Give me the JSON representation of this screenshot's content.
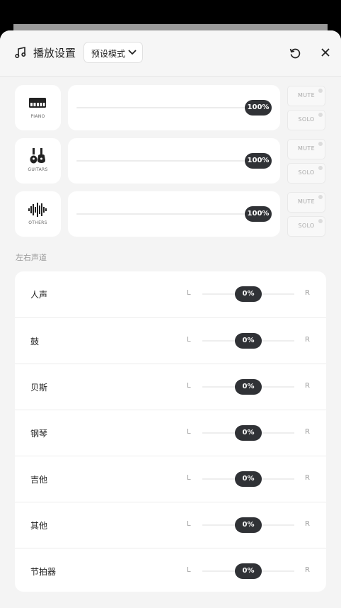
{
  "header": {
    "title": "播放设置",
    "preset_label": "预设模式",
    "icons": {
      "title": "music-note-icon",
      "preset": "chevron-down-icon",
      "reset": "reset-icon",
      "close": "close-icon"
    }
  },
  "tracks": [
    {
      "name": "PIANO",
      "icon": "piano-icon",
      "volume_percent": 100,
      "volume_label": "100%",
      "mute_label": "MUTE",
      "solo_label": "SOLO"
    },
    {
      "name": "GUITARS",
      "icon": "guitars-icon",
      "volume_percent": 100,
      "volume_label": "100%",
      "mute_label": "MUTE",
      "solo_label": "SOLO"
    },
    {
      "name": "OTHERS",
      "icon": "waveform-icon",
      "volume_percent": 100,
      "volume_label": "100%",
      "mute_label": "MUTE",
      "solo_label": "SOLO"
    }
  ],
  "pan_section": {
    "title": "左右声道",
    "left_label": "L",
    "right_label": "R",
    "rows": [
      {
        "name": "人声",
        "pan_value": 0,
        "pan_label": "0%"
      },
      {
        "name": "鼓",
        "pan_value": 0,
        "pan_label": "0%"
      },
      {
        "name": "贝斯",
        "pan_value": 0,
        "pan_label": "0%"
      },
      {
        "name": "钢琴",
        "pan_value": 0,
        "pan_label": "0%"
      },
      {
        "name": "吉他",
        "pan_value": 0,
        "pan_label": "0%"
      },
      {
        "name": "其他",
        "pan_value": 0,
        "pan_label": "0%"
      },
      {
        "name": "节拍器",
        "pan_value": 0,
        "pan_label": "0%"
      }
    ]
  },
  "colors": {
    "thumb": "#303236",
    "card": "#ffffff",
    "sheet": "#f4f4f4"
  }
}
